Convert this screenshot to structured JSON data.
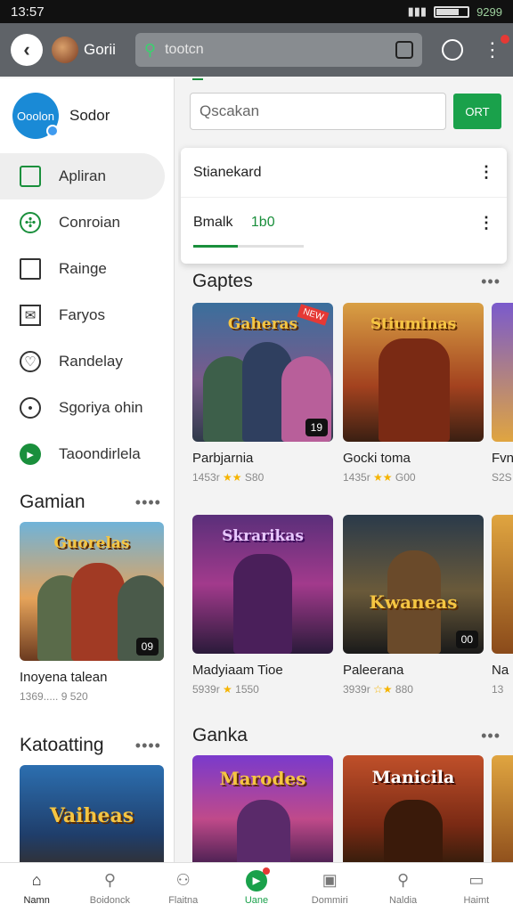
{
  "status": {
    "time": "13:57",
    "right_text": "9299"
  },
  "appbar": {
    "app_name": "Gorii",
    "search_text": "tootcn"
  },
  "drawer": {
    "profile_pic_text": "Ooolon",
    "profile_name": "Sodor",
    "items": [
      {
        "label": "Apliran",
        "icon": "app-icon"
      },
      {
        "label": "Conroian",
        "icon": "puzzle-icon"
      },
      {
        "label": "Rainge",
        "icon": "square-icon"
      },
      {
        "label": "Faryos",
        "icon": "mail-icon"
      },
      {
        "label": "Randelay",
        "icon": "heart-search-icon"
      },
      {
        "label": "Sgoriya ohin",
        "icon": "chat-icon"
      },
      {
        "label": "Taoondirlela",
        "icon": "play-icon"
      }
    ],
    "section1": {
      "title": "Gamian",
      "more": "••••"
    },
    "card1": {
      "art_title": "Guorelas",
      "chip": "09",
      "name": "Inoyena talean",
      "meta": "1369..... 9 520"
    },
    "section2": {
      "title": "Katoatting",
      "more": "••••"
    },
    "card2": {
      "art_title": "Vaiheas"
    }
  },
  "main": {
    "search_placeholder": "Qscakan",
    "get_label": "ORT",
    "dropdown": {
      "row1": "Stianekard",
      "row2_label": "Bmalk",
      "row2_value": "1b0",
      "progress": 0.4
    },
    "section1": {
      "title": "Gaptes",
      "more": "•••"
    },
    "row1": [
      {
        "art": "Gaheras",
        "chip": "19",
        "ribbon": "NEW",
        "name": "Parbjarnia",
        "rating_prefix": "1453r",
        "stars": "★★",
        "rating_suffix": "S80"
      },
      {
        "art": "Stiuminas",
        "name": "Gocki toma",
        "rating_prefix": "1435r",
        "stars": "★★",
        "rating_suffix": "G00"
      },
      {
        "name": "Fvn",
        "rating_prefix": "S2S"
      }
    ],
    "row2": [
      {
        "art": "Skrarikas",
        "name": "Madyiaam Tioe",
        "rating_prefix": "5939r",
        "stars": "★",
        "rating_suffix": "1550"
      },
      {
        "art": "Kwaneas",
        "chip": "00",
        "name": "Paleerana",
        "rating_prefix": "3939r",
        "stars": "☆★",
        "rating_suffix": "880"
      },
      {
        "name": "Na",
        "rating_prefix": "13"
      }
    ],
    "section2": {
      "title": "Ganka",
      "more": "•••"
    },
    "row3": [
      {
        "art": "Marodes"
      },
      {
        "art": "Manicila"
      }
    ]
  },
  "bottomnav": [
    {
      "label": "Namn",
      "icon": "home-icon"
    },
    {
      "label": "Boidonck",
      "icon": "search-icon"
    },
    {
      "label": "Flaitna",
      "icon": "people-icon"
    },
    {
      "label": "Uane",
      "icon": "play-icon"
    },
    {
      "label": "Dommiri",
      "icon": "box-icon"
    },
    {
      "label": "Naldia",
      "icon": "find-icon"
    },
    {
      "label": "Haimt",
      "icon": "tv-icon"
    }
  ]
}
